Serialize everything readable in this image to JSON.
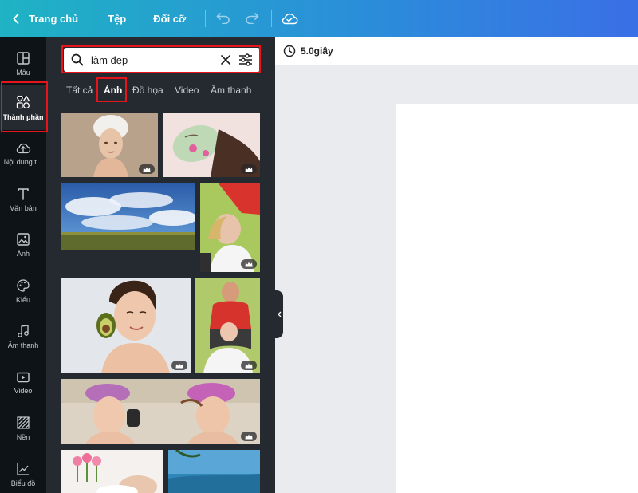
{
  "topbar": {
    "home_label": "Trang chủ",
    "file_label": "Tệp",
    "resize_label": "Đổi cỡ",
    "icons": [
      "chevron-left-icon",
      "undo-icon",
      "redo-icon",
      "cloud-check-icon"
    ]
  },
  "sidebar": {
    "items": [
      {
        "label": "Mẫu",
        "icon": "layout-icon"
      },
      {
        "label": "Thành phần",
        "icon": "shapes-icon"
      },
      {
        "label": "Nội dung tải lên",
        "display": "Nội dung t...",
        "icon": "upload-icon"
      },
      {
        "label": "Văn bản",
        "icon": "text-icon"
      },
      {
        "label": "Ảnh",
        "icon": "image-icon"
      },
      {
        "label": "Kiểu",
        "icon": "palette-icon"
      },
      {
        "label": "Âm thanh",
        "icon": "music-icon"
      },
      {
        "label": "Video",
        "icon": "video-icon"
      },
      {
        "label": "Nền",
        "icon": "background-icon"
      },
      {
        "label": "Biểu đồ",
        "icon": "chart-icon"
      }
    ],
    "active": "Thành phần"
  },
  "search": {
    "value": "làm đẹp"
  },
  "tabs": [
    {
      "label": "Tất cả"
    },
    {
      "label": "Ảnh"
    },
    {
      "label": "Đồ họa"
    },
    {
      "label": "Video"
    },
    {
      "label": "Âm thanh"
    }
  ],
  "active_tab": "Ảnh",
  "canvas": {
    "duration": "5.0giây"
  },
  "colors": {
    "accent_gradient_start": "#1fb3c4",
    "accent_gradient_end": "#3a6fe6",
    "panel_bg": "#252a31",
    "rail_bg": "#0e1318",
    "highlight_red": "#e8141c"
  }
}
